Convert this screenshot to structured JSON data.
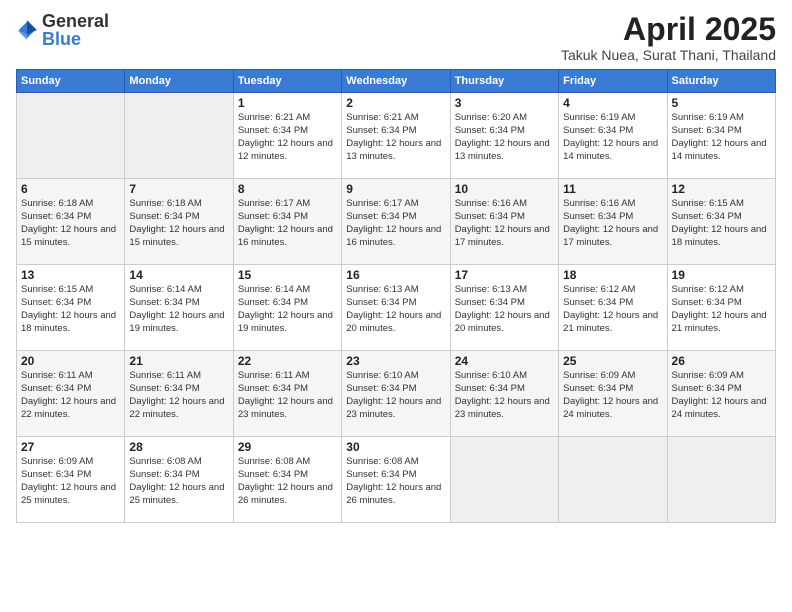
{
  "logo": {
    "text_general": "General",
    "text_blue": "Blue"
  },
  "title": "April 2025",
  "location": "Takuk Nuea, Surat Thani, Thailand",
  "days_of_week": [
    "Sunday",
    "Monday",
    "Tuesday",
    "Wednesday",
    "Thursday",
    "Friday",
    "Saturday"
  ],
  "weeks": [
    [
      {
        "day": "",
        "info": ""
      },
      {
        "day": "",
        "info": ""
      },
      {
        "day": "1",
        "info": "Sunrise: 6:21 AM\nSunset: 6:34 PM\nDaylight: 12 hours and 12 minutes."
      },
      {
        "day": "2",
        "info": "Sunrise: 6:21 AM\nSunset: 6:34 PM\nDaylight: 12 hours and 13 minutes."
      },
      {
        "day": "3",
        "info": "Sunrise: 6:20 AM\nSunset: 6:34 PM\nDaylight: 12 hours and 13 minutes."
      },
      {
        "day": "4",
        "info": "Sunrise: 6:19 AM\nSunset: 6:34 PM\nDaylight: 12 hours and 14 minutes."
      },
      {
        "day": "5",
        "info": "Sunrise: 6:19 AM\nSunset: 6:34 PM\nDaylight: 12 hours and 14 minutes."
      }
    ],
    [
      {
        "day": "6",
        "info": "Sunrise: 6:18 AM\nSunset: 6:34 PM\nDaylight: 12 hours and 15 minutes."
      },
      {
        "day": "7",
        "info": "Sunrise: 6:18 AM\nSunset: 6:34 PM\nDaylight: 12 hours and 15 minutes."
      },
      {
        "day": "8",
        "info": "Sunrise: 6:17 AM\nSunset: 6:34 PM\nDaylight: 12 hours and 16 minutes."
      },
      {
        "day": "9",
        "info": "Sunrise: 6:17 AM\nSunset: 6:34 PM\nDaylight: 12 hours and 16 minutes."
      },
      {
        "day": "10",
        "info": "Sunrise: 6:16 AM\nSunset: 6:34 PM\nDaylight: 12 hours and 17 minutes."
      },
      {
        "day": "11",
        "info": "Sunrise: 6:16 AM\nSunset: 6:34 PM\nDaylight: 12 hours and 17 minutes."
      },
      {
        "day": "12",
        "info": "Sunrise: 6:15 AM\nSunset: 6:34 PM\nDaylight: 12 hours and 18 minutes."
      }
    ],
    [
      {
        "day": "13",
        "info": "Sunrise: 6:15 AM\nSunset: 6:34 PM\nDaylight: 12 hours and 18 minutes."
      },
      {
        "day": "14",
        "info": "Sunrise: 6:14 AM\nSunset: 6:34 PM\nDaylight: 12 hours and 19 minutes."
      },
      {
        "day": "15",
        "info": "Sunrise: 6:14 AM\nSunset: 6:34 PM\nDaylight: 12 hours and 19 minutes."
      },
      {
        "day": "16",
        "info": "Sunrise: 6:13 AM\nSunset: 6:34 PM\nDaylight: 12 hours and 20 minutes."
      },
      {
        "day": "17",
        "info": "Sunrise: 6:13 AM\nSunset: 6:34 PM\nDaylight: 12 hours and 20 minutes."
      },
      {
        "day": "18",
        "info": "Sunrise: 6:12 AM\nSunset: 6:34 PM\nDaylight: 12 hours and 21 minutes."
      },
      {
        "day": "19",
        "info": "Sunrise: 6:12 AM\nSunset: 6:34 PM\nDaylight: 12 hours and 21 minutes."
      }
    ],
    [
      {
        "day": "20",
        "info": "Sunrise: 6:11 AM\nSunset: 6:34 PM\nDaylight: 12 hours and 22 minutes."
      },
      {
        "day": "21",
        "info": "Sunrise: 6:11 AM\nSunset: 6:34 PM\nDaylight: 12 hours and 22 minutes."
      },
      {
        "day": "22",
        "info": "Sunrise: 6:11 AM\nSunset: 6:34 PM\nDaylight: 12 hours and 23 minutes."
      },
      {
        "day": "23",
        "info": "Sunrise: 6:10 AM\nSunset: 6:34 PM\nDaylight: 12 hours and 23 minutes."
      },
      {
        "day": "24",
        "info": "Sunrise: 6:10 AM\nSunset: 6:34 PM\nDaylight: 12 hours and 23 minutes."
      },
      {
        "day": "25",
        "info": "Sunrise: 6:09 AM\nSunset: 6:34 PM\nDaylight: 12 hours and 24 minutes."
      },
      {
        "day": "26",
        "info": "Sunrise: 6:09 AM\nSunset: 6:34 PM\nDaylight: 12 hours and 24 minutes."
      }
    ],
    [
      {
        "day": "27",
        "info": "Sunrise: 6:09 AM\nSunset: 6:34 PM\nDaylight: 12 hours and 25 minutes."
      },
      {
        "day": "28",
        "info": "Sunrise: 6:08 AM\nSunset: 6:34 PM\nDaylight: 12 hours and 25 minutes."
      },
      {
        "day": "29",
        "info": "Sunrise: 6:08 AM\nSunset: 6:34 PM\nDaylight: 12 hours and 26 minutes."
      },
      {
        "day": "30",
        "info": "Sunrise: 6:08 AM\nSunset: 6:34 PM\nDaylight: 12 hours and 26 minutes."
      },
      {
        "day": "",
        "info": ""
      },
      {
        "day": "",
        "info": ""
      },
      {
        "day": "",
        "info": ""
      }
    ]
  ]
}
